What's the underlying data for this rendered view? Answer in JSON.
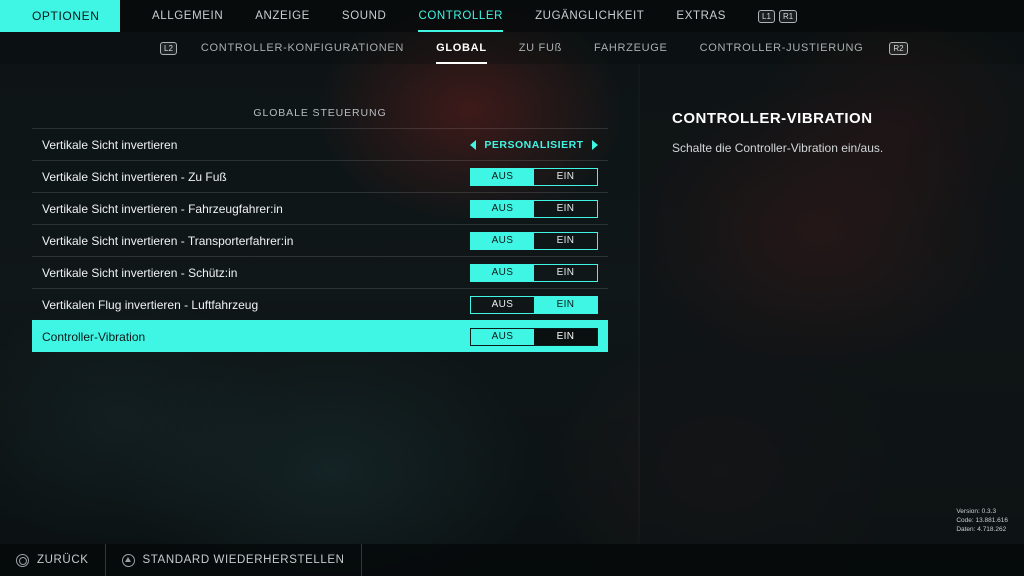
{
  "top_nav": {
    "options_label": "OPTIONEN",
    "tabs": [
      {
        "label": "ALLGEMEIN"
      },
      {
        "label": "ANZEIGE"
      },
      {
        "label": "SOUND"
      },
      {
        "label": "CONTROLLER",
        "active": true
      },
      {
        "label": "ZUGÄNGLICHKEIT"
      },
      {
        "label": "EXTRAS"
      }
    ],
    "key_hints": [
      "L1",
      "R1"
    ]
  },
  "sub_nav": {
    "key_left": "L2",
    "key_right": "R2",
    "tabs": [
      {
        "label": "CONTROLLER-KONFIGURATIONEN"
      },
      {
        "label": "GLOBAL",
        "active": true
      },
      {
        "label": "ZU FUß"
      },
      {
        "label": "FAHRZEUGE"
      },
      {
        "label": "CONTROLLER-JUSTIERUNG"
      }
    ]
  },
  "settings": {
    "section_title": "GLOBALE STEUERUNG",
    "rows": [
      {
        "label": "Vertikale Sicht invertieren",
        "type": "selector",
        "value": "PERSONALISIERT"
      },
      {
        "label": "Vertikale Sicht invertieren - Zu Fuß",
        "type": "toggle",
        "off": "AUS",
        "on": "EIN",
        "selected_value": "AUS"
      },
      {
        "label": "Vertikale Sicht invertieren - Fahrzeugfahrer:in",
        "type": "toggle",
        "off": "AUS",
        "on": "EIN",
        "selected_value": "AUS"
      },
      {
        "label": "Vertikale Sicht invertieren - Transporterfahrer:in",
        "type": "toggle",
        "off": "AUS",
        "on": "EIN",
        "selected_value": "AUS"
      },
      {
        "label": "Vertikale Sicht invertieren - Schütz:in",
        "type": "toggle",
        "off": "AUS",
        "on": "EIN",
        "selected_value": "AUS"
      },
      {
        "label": "Vertikalen Flug invertieren - Luftfahrzeug",
        "type": "toggle",
        "off": "AUS",
        "on": "EIN",
        "selected_value": "EIN"
      },
      {
        "label": "Controller-Vibration",
        "type": "toggle",
        "off": "AUS",
        "on": "EIN",
        "selected_value": "EIN",
        "highlighted": true
      }
    ]
  },
  "detail": {
    "title": "CONTROLLER-VIBRATION",
    "description": "Schalte die Controller-Vibration ein/aus."
  },
  "version_info": {
    "version": "Version: 0.3.3",
    "code": "Code: 13.881.616",
    "data": "Daten: 4.718.262"
  },
  "bottom_bar": {
    "back_label": "ZURÜCK",
    "reset_label": "STANDARD WIEDERHERSTELLEN"
  },
  "colors": {
    "accent": "#3ff5e3"
  }
}
